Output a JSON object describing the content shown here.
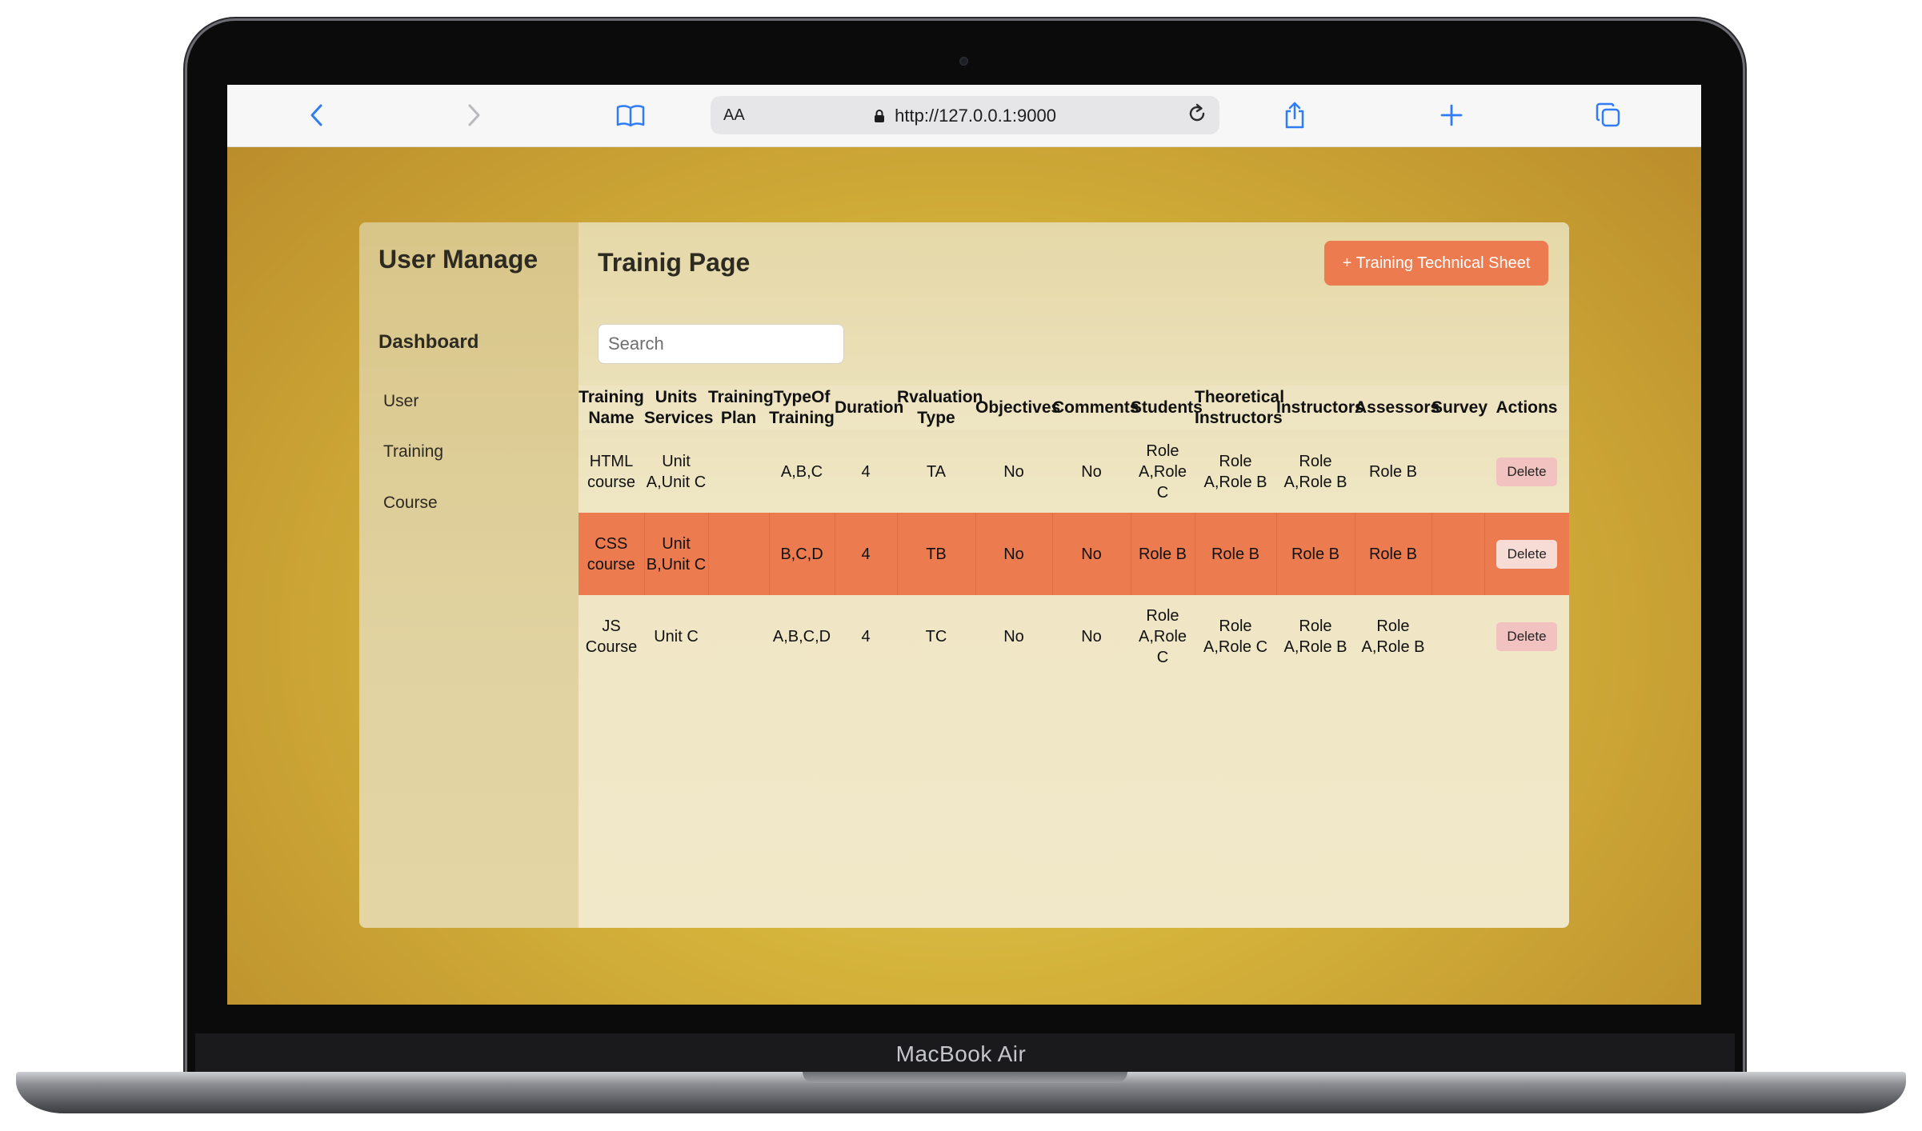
{
  "device": {
    "brand_label": "MacBook Air"
  },
  "browser": {
    "text_size_label": "AA",
    "url": "http://127.0.0.1:9000",
    "icons": [
      "back-icon",
      "forward-icon",
      "bookmarks-icon",
      "lock-icon",
      "reload-icon",
      "share-icon",
      "new-tab-icon",
      "tabs-icon"
    ]
  },
  "sidebar": {
    "title": "User Manage",
    "dashboard_label": "Dashboard",
    "items": [
      {
        "label": "User"
      },
      {
        "label": "Training"
      },
      {
        "label": "Course"
      }
    ]
  },
  "main": {
    "title": "Trainig Page",
    "add_button_label": "+ Training Technical Sheet",
    "search_placeholder": "Search",
    "accent_color": "#ec7b50"
  },
  "table": {
    "columns": [
      "Training Name",
      "Units Services",
      "Training Plan",
      "TypeOf Training",
      "Duration",
      "Rvaluation Type",
      "Objectives",
      "Comments",
      "Students",
      "Theoretical Instructors",
      "Instructors",
      "Assessors",
      "Survey",
      "Actions"
    ],
    "rows": [
      {
        "highlighted": false,
        "cells": [
          "HTML course",
          "Unit A,Unit C",
          "",
          "A,B,C",
          "4",
          "TA",
          "No",
          "No",
          "Role A,Role C",
          "Role A,Role B",
          "Role A,Role B",
          "Role B",
          ""
        ],
        "action_label": "Delete"
      },
      {
        "highlighted": true,
        "cells": [
          "CSS course",
          "Unit B,Unit C",
          "",
          "B,C,D",
          "4",
          "TB",
          "No",
          "No",
          "Role B",
          "Role B",
          "Role B",
          "Role B",
          ""
        ],
        "action_label": "Delete"
      },
      {
        "highlighted": false,
        "cells": [
          "JS Course",
          "Unit C",
          "",
          "A,B,C,D",
          "4",
          "TC",
          "No",
          "No",
          "Role A,Role C",
          "Role A,Role C",
          "Role A,Role B",
          "Role A,Role B",
          ""
        ],
        "action_label": "Delete"
      }
    ]
  }
}
